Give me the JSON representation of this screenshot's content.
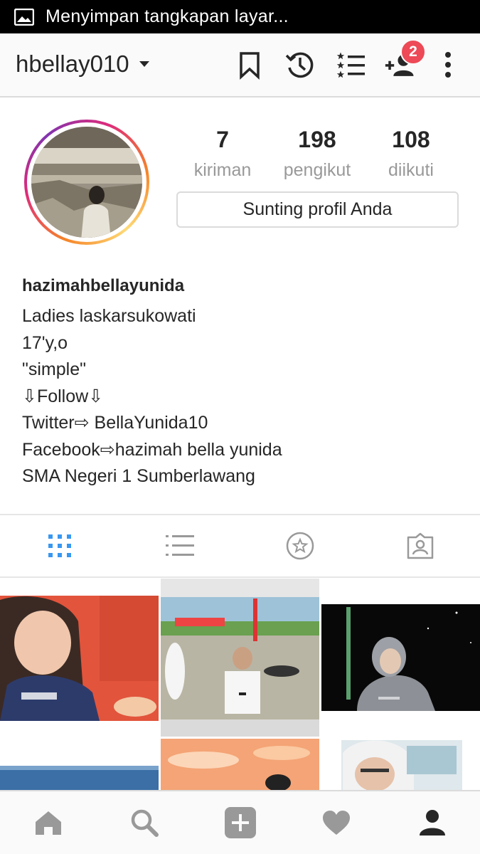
{
  "status_bar": {
    "text": "Menyimpan tangkapan layar...",
    "icon": "gallery-icon"
  },
  "top_bar": {
    "username": "hbellay010",
    "icons": [
      "bookmark-icon",
      "history-icon",
      "close-friends-icon",
      "discover-people-icon",
      "more-options-icon"
    ],
    "notification_count": "2"
  },
  "profile": {
    "stats": [
      {
        "value": "7",
        "label": "kiriman"
      },
      {
        "value": "198",
        "label": "pengikut"
      },
      {
        "value": "108",
        "label": "diikuti"
      }
    ],
    "edit_button": "Sunting profil Anda",
    "full_name": "hazimahbellayunida",
    "bio": [
      "Ladies laskarsukowati",
      "17'y,o",
      "\"simple\"",
      "⇩Follow⇩",
      "Twitter⇨ BellaYunida10",
      "Facebook⇨hazimah bella yunida",
      "SMA Negeri 1 Sumberlawang"
    ]
  },
  "tabs": [
    {
      "name": "grid-view",
      "icon": "grid-icon",
      "active": true
    },
    {
      "name": "list-view",
      "icon": "list-icon",
      "active": false
    },
    {
      "name": "saved",
      "icon": "star-icon",
      "active": false
    },
    {
      "name": "tagged",
      "icon": "tagged-icon",
      "active": false
    }
  ],
  "bottom_nav": [
    "home-icon",
    "search-icon",
    "add-post-icon",
    "activity-heart-icon",
    "profile-icon"
  ],
  "colors": {
    "accent_blue": "#3897f0",
    "badge_red": "#ed4956",
    "text_dark": "#262626",
    "text_muted": "#999999",
    "border": "#dbdbdb"
  }
}
